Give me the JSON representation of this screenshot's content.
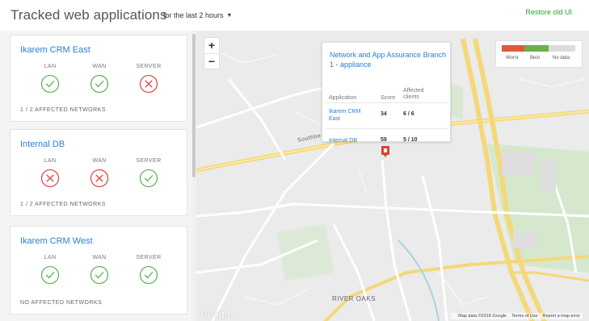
{
  "header": {
    "title": "Tracked web applications",
    "time_filter": "for the last 2 hours",
    "restore_link": "Restore old UI"
  },
  "apps": [
    {
      "name": "Ikarem CRM East",
      "metrics": [
        {
          "label": "LAN",
          "status": "ok"
        },
        {
          "label": "WAN",
          "status": "ok"
        },
        {
          "label": "SERVER",
          "status": "fail"
        }
      ],
      "affected": "1 / 2 AFFECTED NETWORKS"
    },
    {
      "name": "Internal DB",
      "metrics": [
        {
          "label": "LAN",
          "status": "fail"
        },
        {
          "label": "WAN",
          "status": "fail"
        },
        {
          "label": "SERVER",
          "status": "ok"
        }
      ],
      "affected": "1 / 2 AFFECTED NETWORKS"
    },
    {
      "name": "Ikarem CRM West",
      "metrics": [
        {
          "label": "LAN",
          "status": "ok"
        },
        {
          "label": "WAN",
          "status": "ok"
        },
        {
          "label": "SERVER",
          "status": "ok"
        }
      ],
      "affected": "NO AFFECTED NETWORKS"
    }
  ],
  "status_icons": {
    "ok": "check-circle-icon",
    "fail": "x-circle-icon"
  },
  "colors": {
    "ok": "#5cb85c",
    "fail": "#e04b4b",
    "link": "#2a7fd4",
    "restore": "#2ea12e",
    "legend_worst": "#e05a3a",
    "legend_best": "#6ab04c",
    "legend_nodata": "#dcdcdc",
    "pin": "#e0402c"
  },
  "map": {
    "zoom_in": "+",
    "zoom_out": "−",
    "popup": {
      "title": "Network and App Assurance Branch 1 - appliance",
      "columns": [
        "Application",
        "Score",
        "Affected clients"
      ],
      "rows": [
        {
          "app": "Ikarem CRM East",
          "score": "34",
          "clients": "6 / 6"
        },
        {
          "app": "Internal DB",
          "score": "59",
          "clients": "5 / 10"
        }
      ]
    },
    "legend": {
      "worst": "Worst",
      "best": "Best",
      "nodata": "No data"
    },
    "labels": {
      "street": "Southbe",
      "district": "RIVER OAKS"
    },
    "footer": {
      "map_data": "Map data ©2018 Google",
      "terms": "Terms of Use",
      "report": "Report a map error"
    },
    "google": "Google"
  }
}
